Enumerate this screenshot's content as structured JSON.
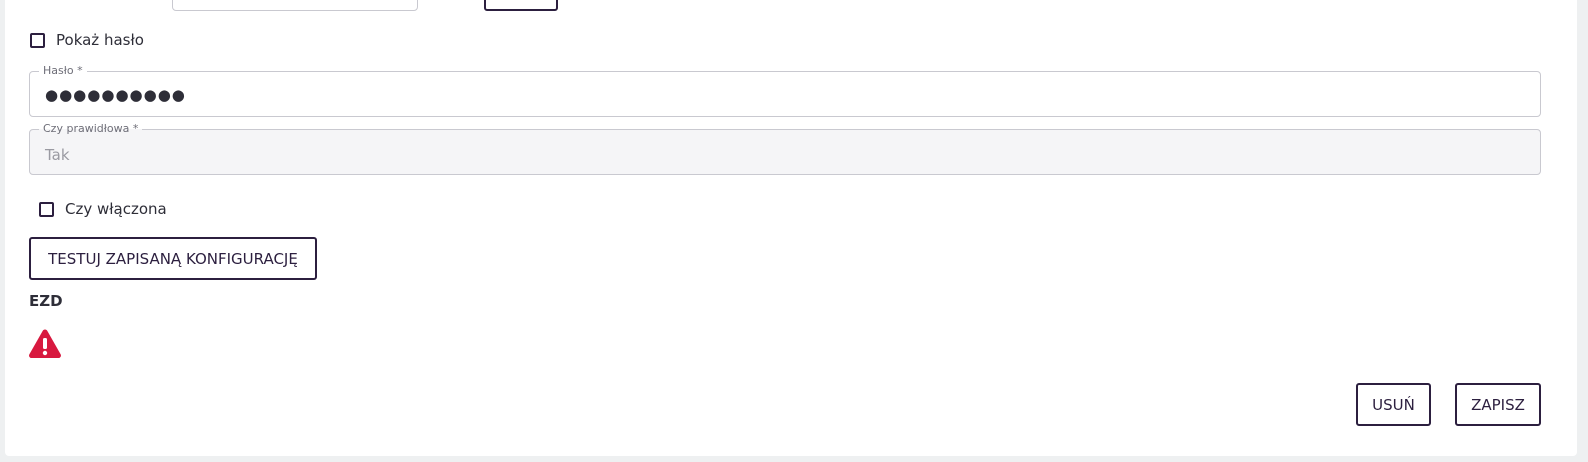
{
  "form": {
    "show_password_label": "Pokaż hasło",
    "password": {
      "label": "Hasło *",
      "value": "●●●●●●●●●●"
    },
    "valid": {
      "label": "Czy prawidłowa *",
      "value": "Tak"
    },
    "enabled_label": "Czy włączona",
    "test_button_label": "TESTUJ ZAPISANĄ KONFIGURACJĘ"
  },
  "section": {
    "title": "EZD",
    "status_icon": "warning-triangle-icon",
    "status_color": "#d8193f"
  },
  "actions": {
    "delete_label": "USUŃ",
    "save_label": "ZAPISZ"
  }
}
